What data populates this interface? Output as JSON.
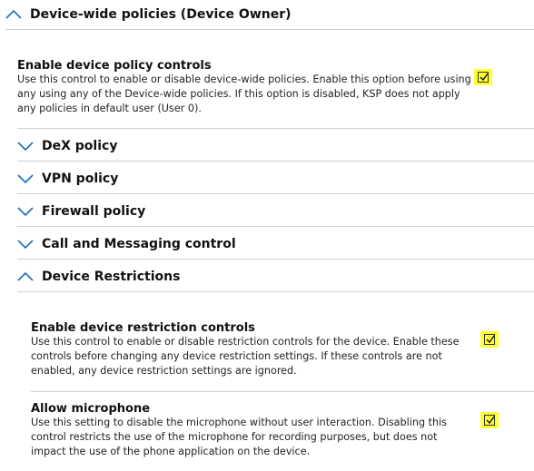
{
  "main_section": {
    "title": "Device-wide policies (Device Owner)",
    "expanded": true
  },
  "enable_policy": {
    "title": "Enable device policy controls",
    "description": "Use this control to enable or disable device-wide policies. Enable this option before using any using any of the Device-wide policies. If this option is disabled, KSP does not apply any policies in default user (User 0).",
    "checked": true
  },
  "sections": [
    {
      "label": "DeX policy",
      "expanded": false
    },
    {
      "label": "VPN policy",
      "expanded": false
    },
    {
      "label": "Firewall policy",
      "expanded": false
    },
    {
      "label": "Call and Messaging control",
      "expanded": false
    },
    {
      "label": "Device Restrictions",
      "expanded": true
    }
  ],
  "restrictions": {
    "enable_controls": {
      "title": "Enable device restriction controls",
      "description": "Use this control to enable or disable restriction controls for the device. Enable these controls before changing any device restriction settings. If these controls are not enabled, any device restriction settings are ignored.",
      "checked": true
    },
    "allow_microphone": {
      "title": "Allow microphone",
      "description": "Use this setting to disable the microphone without user interaction. Disabling this control restricts the use of the microphone for recording purposes, but does not impact the use of the phone application on the device.",
      "checked": true
    }
  },
  "colors": {
    "highlight": "#ffff33",
    "accent": "#1a6fb5",
    "divider": "#cfcfcf"
  }
}
